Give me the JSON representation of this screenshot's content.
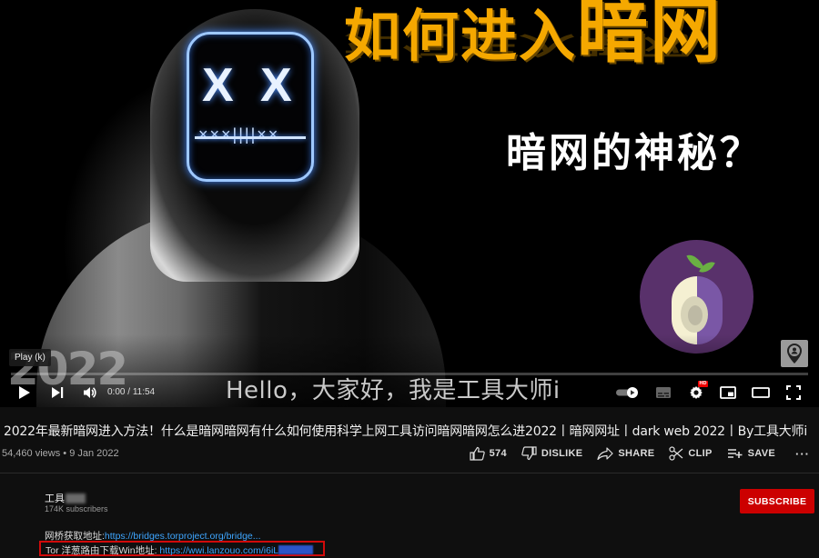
{
  "player": {
    "thumbnail": {
      "headline_part1": "如何进入",
      "headline_part2": "暗网",
      "subheadline": "暗网的神秘？",
      "year_watermark": "2022",
      "mask_eye": "X"
    },
    "tooltip": "Play (k)",
    "caption": "Hello，大家好，我是工具大师i",
    "time_current": "0:00",
    "time_separator": " / ",
    "time_total": "11:54",
    "progress_fraction": 0.0,
    "hd_badge": "HD",
    "controls": {
      "play": "play-icon",
      "next": "next-icon",
      "volume": "volume-icon",
      "autoplay": "autoplay-toggle-icon",
      "subtitles": "subtitles-icon",
      "settings": "settings-icon",
      "miniplayer": "miniplayer-icon",
      "theater": "theater-mode-icon",
      "fullscreen": "fullscreen-icon"
    }
  },
  "video": {
    "title": "2022年最新暗网进入方法！什么是暗网暗网有什么如何使用科学上网工具访问暗网暗网怎么进2022丨暗网网址丨dark web 2022丨By工具大师i",
    "views": "54,460 views",
    "dot": " • ",
    "date": "9 Jan 2022",
    "actions": {
      "like_count": "574",
      "dislike": "DISLIKE",
      "share": "SHARE",
      "clip": "CLIP",
      "save": "SAVE",
      "more": "···"
    }
  },
  "channel": {
    "name_visible": "工具",
    "subscribers": "174K subscribers",
    "subscribe_label": "SUBSCRIBE",
    "subscribe_color": "#cc0000"
  },
  "description": {
    "line1_label": "网桥获取地址:",
    "line1_link": "https://bridges.torproject.org/bridge...",
    "line2_label": "Tor 洋葱路由下载Win地址: ",
    "line2_link": "https://wwi.lanzouo.com/i6iL",
    "highlight_color": "#d10a0a",
    "link_color": "#3ea6ff"
  }
}
